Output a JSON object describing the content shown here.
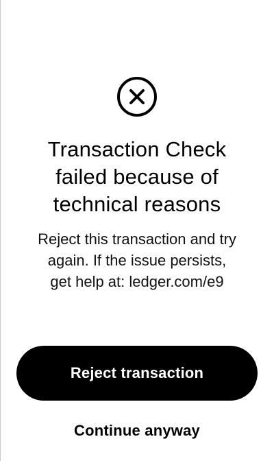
{
  "status": {
    "icon": "close-circle-icon",
    "title": "Transaction Check\nfailed because of\ntechnical reasons",
    "description": "Reject this transaction and try\nagain. If the issue persists,\nget help at: ledger.com/e9"
  },
  "actions": {
    "reject_label": "Reject transaction",
    "continue_label": "Continue anyway"
  },
  "colors": {
    "background": "#ffffff",
    "text": "#000000",
    "primary_button_bg": "#000000",
    "primary_button_text": "#ffffff"
  }
}
